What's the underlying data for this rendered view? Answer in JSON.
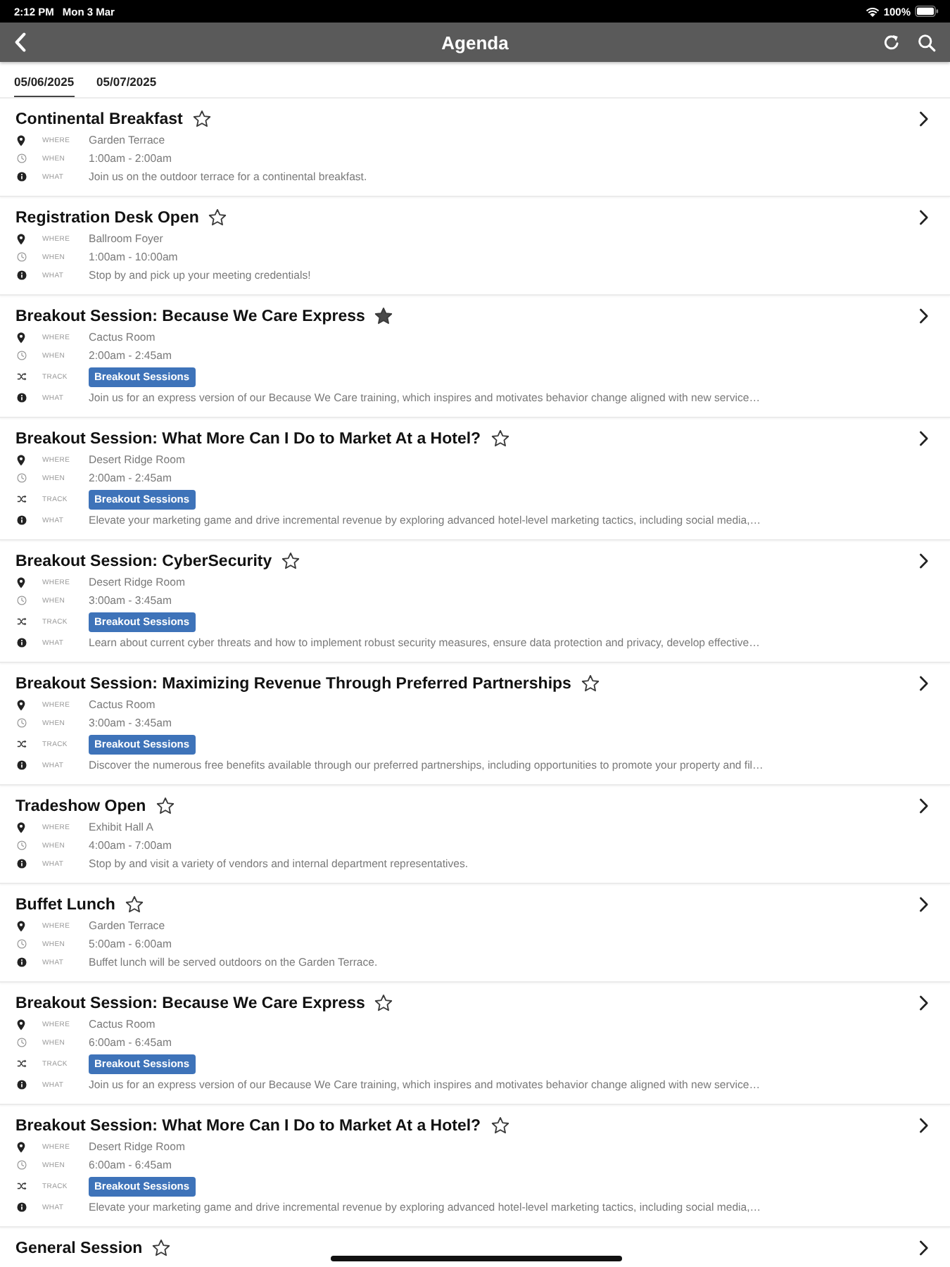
{
  "status_bar": {
    "time": "2:12 PM",
    "date": "Mon 3 Mar",
    "battery": "100%"
  },
  "header": {
    "title": "Agenda"
  },
  "tabs": [
    {
      "label": "05/06/2025",
      "selected": true
    },
    {
      "label": "05/07/2025",
      "selected": false
    }
  ],
  "sessions": [
    {
      "title": "Continental Breakfast",
      "favorite": false,
      "details": [
        {
          "kind": "where",
          "label": "WHERE",
          "value": "Garden Terrace"
        },
        {
          "kind": "when",
          "label": "WHEN",
          "value": "1:00am - 2:00am"
        },
        {
          "kind": "what",
          "label": "WHAT",
          "value": "Join us on the outdoor terrace for a continental breakfast."
        }
      ]
    },
    {
      "title": "Registration Desk Open",
      "favorite": false,
      "details": [
        {
          "kind": "where",
          "label": "WHERE",
          "value": "Ballroom Foyer"
        },
        {
          "kind": "when",
          "label": "WHEN",
          "value": "1:00am - 10:00am"
        },
        {
          "kind": "what",
          "label": "WHAT",
          "value": "Stop by and pick up your meeting credentials!"
        }
      ]
    },
    {
      "title": "Breakout Session: Because We Care Express",
      "favorite": true,
      "details": [
        {
          "kind": "where",
          "label": "WHERE",
          "value": "Cactus Room"
        },
        {
          "kind": "when",
          "label": "WHEN",
          "value": "2:00am - 2:45am"
        },
        {
          "kind": "track",
          "label": "TRACK",
          "value": "Breakout Sessions"
        },
        {
          "kind": "what",
          "label": "WHAT",
          "value": "Join us for an express version of our Because We Care training, which inspires and motivates behavior change aligned with new service…"
        }
      ]
    },
    {
      "title": "Breakout Session: What More Can I Do to Market At a Hotel?",
      "favorite": false,
      "details": [
        {
          "kind": "where",
          "label": "WHERE",
          "value": "Desert Ridge Room"
        },
        {
          "kind": "when",
          "label": "WHEN",
          "value": "2:00am - 2:45am"
        },
        {
          "kind": "track",
          "label": "TRACK",
          "value": "Breakout Sessions"
        },
        {
          "kind": "what",
          "label": "WHAT",
          "value": "Elevate your marketing game and drive incremental revenue by exploring advanced hotel-level marketing tactics, including social media,…"
        }
      ]
    },
    {
      "title": "Breakout Session: CyberSecurity",
      "favorite": false,
      "details": [
        {
          "kind": "where",
          "label": "WHERE",
          "value": "Desert Ridge Room"
        },
        {
          "kind": "when",
          "label": "WHEN",
          "value": "3:00am - 3:45am"
        },
        {
          "kind": "track",
          "label": "TRACK",
          "value": "Breakout Sessions"
        },
        {
          "kind": "what",
          "label": "WHAT",
          "value": "Learn about current cyber threats and how to implement robust security measures, ensure data protection and privacy, develop effective…"
        }
      ]
    },
    {
      "title": "Breakout Session: Maximizing Revenue Through Preferred Partnerships",
      "favorite": false,
      "details": [
        {
          "kind": "where",
          "label": "WHERE",
          "value": "Cactus Room"
        },
        {
          "kind": "when",
          "label": "WHEN",
          "value": "3:00am - 3:45am"
        },
        {
          "kind": "track",
          "label": "TRACK",
          "value": "Breakout Sessions"
        },
        {
          "kind": "what",
          "label": "WHAT",
          "value": "Discover the numerous free benefits available through our preferred partnerships, including opportunities to promote your property and fil…"
        }
      ]
    },
    {
      "title": "Tradeshow Open",
      "favorite": false,
      "details": [
        {
          "kind": "where",
          "label": "WHERE",
          "value": "Exhibit Hall A"
        },
        {
          "kind": "when",
          "label": "WHEN",
          "value": "4:00am - 7:00am"
        },
        {
          "kind": "what",
          "label": "WHAT",
          "value": "Stop by and visit a variety of vendors and internal department representatives."
        }
      ]
    },
    {
      "title": "Buffet Lunch",
      "favorite": false,
      "details": [
        {
          "kind": "where",
          "label": "WHERE",
          "value": "Garden Terrace"
        },
        {
          "kind": "when",
          "label": "WHEN",
          "value": "5:00am - 6:00am"
        },
        {
          "kind": "what",
          "label": "WHAT",
          "value": "Buffet lunch will be served outdoors on the Garden Terrace."
        }
      ]
    },
    {
      "title": "Breakout Session: Because We Care Express",
      "favorite": false,
      "details": [
        {
          "kind": "where",
          "label": "WHERE",
          "value": "Cactus Room"
        },
        {
          "kind": "when",
          "label": "WHEN",
          "value": "6:00am - 6:45am"
        },
        {
          "kind": "track",
          "label": "TRACK",
          "value": "Breakout Sessions"
        },
        {
          "kind": "what",
          "label": "WHAT",
          "value": "Join us for an express version of our Because We Care training, which inspires and motivates behavior change aligned with new service…"
        }
      ]
    },
    {
      "title": "Breakout Session: What More Can I Do to Market At a Hotel?",
      "favorite": false,
      "details": [
        {
          "kind": "where",
          "label": "WHERE",
          "value": "Desert Ridge Room"
        },
        {
          "kind": "when",
          "label": "WHEN",
          "value": "6:00am - 6:45am"
        },
        {
          "kind": "track",
          "label": "TRACK",
          "value": "Breakout Sessions"
        },
        {
          "kind": "what",
          "label": "WHAT",
          "value": "Elevate your marketing game and drive incremental revenue by exploring advanced hotel-level marketing tactics, including social media,…"
        }
      ]
    },
    {
      "title": "General Session",
      "favorite": false
    }
  ]
}
